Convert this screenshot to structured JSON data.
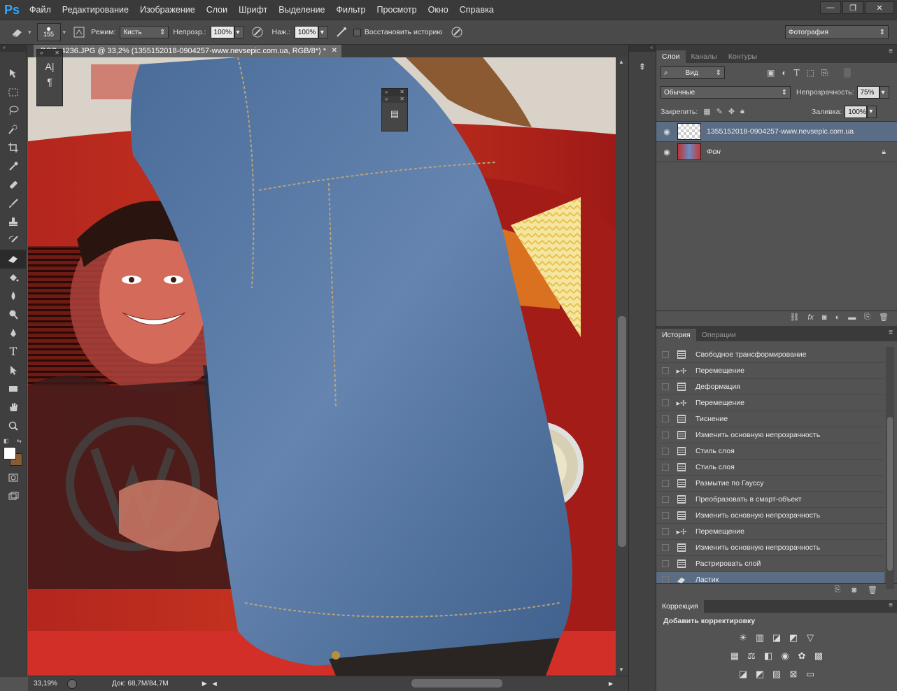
{
  "app": {
    "logo": "Ps"
  },
  "menu": [
    "Файл",
    "Редактирование",
    "Изображение",
    "Слои",
    "Шрифт",
    "Выделение",
    "Фильтр",
    "Просмотр",
    "Окно",
    "Справка"
  ],
  "window_controls": {
    "minimize": "—",
    "restore": "❐",
    "close": "✕"
  },
  "options": {
    "brush_size": "155",
    "mode_label": "Режим:",
    "mode_value": "Кисть",
    "opacity_label": "Непрозр.:",
    "opacity_value": "100%",
    "pressure_label": "Наж.:",
    "pressure_value": "100%",
    "restore_history_label": "Восстановить историю",
    "workspace": "Фотография"
  },
  "tools": [
    "move-icon",
    "marquee-icon",
    "lasso-icon",
    "quick-select-icon",
    "crop-icon",
    "eyedropper-icon",
    "healing-icon",
    "brush-icon",
    "stamp-icon",
    "history-brush-icon",
    "eraser-icon",
    "bucket-icon",
    "blur-icon",
    "dodge-icon",
    "pen-icon",
    "type-icon",
    "path-select-icon",
    "shape-icon",
    "hand-icon",
    "zoom-icon"
  ],
  "document": {
    "tab_title": "DSC_4236.JPG @ 33,2% (1355152018-0904257-www.nevsepic.com.ua, RGB/8*) *",
    "zoom": "33,19%",
    "doc_info": "Док: 68,7M/84,7M"
  },
  "layers_panel": {
    "tabs": [
      "Слои",
      "Каналы",
      "Контуры"
    ],
    "filter_kind": "Вид",
    "blend_mode": "Обычные",
    "opacity_label": "Непрозрачность:",
    "opacity_value": "75%",
    "lock_label": "Закрепить:",
    "fill_label": "Заливка:",
    "fill_value": "100%",
    "layers": [
      {
        "name": "1355152018-0904257-www.nevsepic.com.ua",
        "selected": true
      },
      {
        "name": "Фон",
        "selected": false
      }
    ]
  },
  "history_panel": {
    "tabs": [
      "История",
      "Операции"
    ],
    "items": [
      {
        "label": "Свободное трансформирование",
        "icon": "doc"
      },
      {
        "label": "Перемещение",
        "icon": "move"
      },
      {
        "label": "Деформация",
        "icon": "doc"
      },
      {
        "label": "Перемещение",
        "icon": "move"
      },
      {
        "label": "Тиснение",
        "icon": "doc"
      },
      {
        "label": "Изменить основную непрозрачность",
        "icon": "doc"
      },
      {
        "label": "Стиль слоя",
        "icon": "doc"
      },
      {
        "label": "Стиль слоя",
        "icon": "doc"
      },
      {
        "label": "Размытие по Гауссу",
        "icon": "doc"
      },
      {
        "label": "Преобразовать в смарт-объект",
        "icon": "doc"
      },
      {
        "label": "Изменить основную непрозрачность",
        "icon": "doc"
      },
      {
        "label": "Перемещение",
        "icon": "move"
      },
      {
        "label": "Изменить основную непрозрачность",
        "icon": "doc"
      },
      {
        "label": "Растрировать слой",
        "icon": "doc"
      },
      {
        "label": "Ластик",
        "icon": "eraser",
        "selected": true
      }
    ]
  },
  "adjustments_panel": {
    "tab": "Коррекция",
    "heading": "Добавить корректировку"
  },
  "colors": {
    "selection": "#5b6d85",
    "accent": "#31a8ff"
  }
}
